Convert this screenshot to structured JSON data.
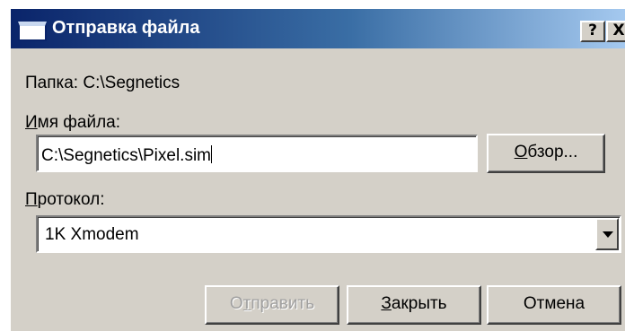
{
  "window": {
    "title": "Отправка файла",
    "help_button": "?",
    "close_button": "X"
  },
  "folder": {
    "label": "Папка: C:\\Segnetics"
  },
  "filename": {
    "label_prefix": "",
    "label_mnemonic": "И",
    "label_rest": "мя файла:",
    "value": "C:\\Segnetics\\Pixel.sim"
  },
  "browse_button": {
    "mnemonic": "О",
    "rest": "бзор..."
  },
  "protocol": {
    "label_mnemonic": "П",
    "label_rest": "ротокол:",
    "selected": "1K Xmodem"
  },
  "buttons": {
    "send_prefix": "О",
    "send_mnemonic": "т",
    "send_rest": "править",
    "send_enabled": false,
    "close_mnemonic": "З",
    "close_rest": "акрыть",
    "cancel": "Отмена"
  },
  "colors": {
    "titlebar_start": "#0a246a",
    "titlebar_end": "#a6caf0",
    "face": "#d4d0c8",
    "disabled_text": "#a0a0a0"
  }
}
